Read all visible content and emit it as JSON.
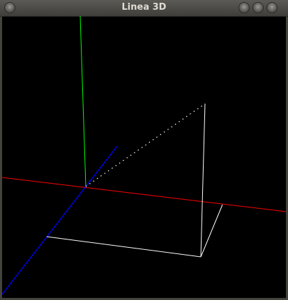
{
  "window": {
    "title": "Linea 3D",
    "controls": [
      "menu",
      "minimize",
      "maximize",
      "close"
    ]
  },
  "scene": {
    "background": "#000000",
    "axes": [
      {
        "name": "x-axis",
        "color": "#ff0000"
      },
      {
        "name": "y-axis",
        "color": "#00ff00"
      },
      {
        "name": "z-axis",
        "color": "#0000ff"
      }
    ],
    "line_color": "#ffffff"
  }
}
